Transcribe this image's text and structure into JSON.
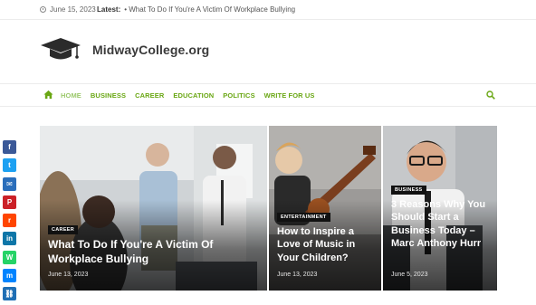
{
  "topbar": {
    "date": "June 15, 2023",
    "latest_label": "Latest:",
    "latest_headline": "• What To Do If You're A Victim Of Workplace Bullying"
  },
  "header": {
    "site_name": "MidwayCollege.org",
    "logo_icon": "graduation-cap-icon"
  },
  "nav": {
    "items": [
      {
        "label": "HOME"
      },
      {
        "label": "BUSINESS"
      },
      {
        "label": "CAREER"
      },
      {
        "label": "EDUCATION"
      },
      {
        "label": "POLITICS"
      },
      {
        "label": "WRITE FOR US"
      }
    ],
    "accent_color": "#6aa714"
  },
  "social": [
    {
      "name": "facebook",
      "color": "#3b5998",
      "glyph": "f"
    },
    {
      "name": "twitter",
      "color": "#1da1f2",
      "glyph": "t"
    },
    {
      "name": "email",
      "color": "#2a6ebb",
      "glyph": "✉"
    },
    {
      "name": "pinterest",
      "color": "#cb2027",
      "glyph": "P"
    },
    {
      "name": "reddit",
      "color": "#ff4500",
      "glyph": "r"
    },
    {
      "name": "linkedin",
      "color": "#0e76a8",
      "glyph": "in"
    },
    {
      "name": "whatsapp",
      "color": "#25d366",
      "glyph": "W"
    },
    {
      "name": "messenger",
      "color": "#0084ff",
      "glyph": "m"
    },
    {
      "name": "copy-link",
      "color": "#1f6fb5",
      "glyph": "⛓"
    }
  ],
  "cards": [
    {
      "category": "CAREER",
      "title": "What To Do If You're A Victim Of Workplace Bullying",
      "date": "June 13, 2023"
    },
    {
      "category": "ENTERTAINMENT",
      "title": "How to Inspire a Love of Music in Your Children?",
      "date": "June 13, 2023"
    },
    {
      "category": "BUSINESS",
      "title": "3 Reasons Why You Should Start a Business Today – Marc Anthony Hurr",
      "date": "June 5, 2023"
    }
  ]
}
